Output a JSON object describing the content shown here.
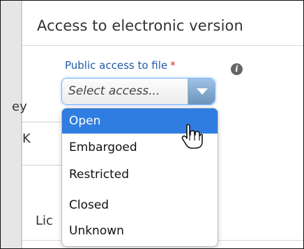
{
  "header": {
    "title": "Access to electronic version"
  },
  "field": {
    "label": "Public access to file",
    "required_mark": "*",
    "placeholder": "Select access..."
  },
  "peek": {
    "ey": "ey",
    "k": "K",
    "lic": "Lic"
  },
  "dropdown": {
    "options": [
      {
        "label": "Open"
      },
      {
        "label": "Embargoed"
      },
      {
        "label": "Restricted"
      },
      {
        "label": "Closed"
      },
      {
        "label": "Unknown"
      }
    ]
  },
  "icons": {
    "info": "info-icon",
    "chevron": "chevron-down-icon",
    "cursor": "hand-pointer-icon"
  },
  "colors": {
    "accent": "#2f7de1",
    "label": "#1f5aa6",
    "required": "#c0392b"
  }
}
